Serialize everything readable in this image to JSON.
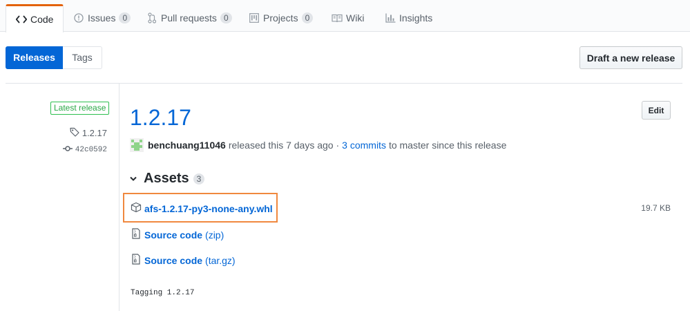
{
  "tabs": [
    {
      "label": "Code",
      "icon": "code-icon",
      "count": null
    },
    {
      "label": "Issues",
      "icon": "issue-icon",
      "count": "0"
    },
    {
      "label": "Pull requests",
      "icon": "pull-request-icon",
      "count": "0"
    },
    {
      "label": "Projects",
      "icon": "project-icon",
      "count": "0"
    },
    {
      "label": "Wiki",
      "icon": "book-icon",
      "count": null
    },
    {
      "label": "Insights",
      "icon": "graph-icon",
      "count": null
    }
  ],
  "subnav": {
    "releases": "Releases",
    "tags": "Tags"
  },
  "actions": {
    "draft": "Draft a new release",
    "edit": "Edit"
  },
  "release": {
    "badge": "Latest release",
    "tag": "1.2.17",
    "commit": "42c0592",
    "title": "1.2.17",
    "author": "benchuang11046",
    "released_text": "released this 7 days ago ·",
    "commits_link": "3 commits",
    "commits_suffix": "to master since this release",
    "assets_title": "Assets",
    "assets_count": "3",
    "assets": [
      {
        "name": "afs-1.2.17-py3-none-any.whl",
        "size": "19.7 KB"
      },
      {
        "name": "Source code",
        "format": "(zip)"
      },
      {
        "name": "Source code",
        "format": "(tar.gz)"
      }
    ],
    "tag_message": "Tagging 1.2.17"
  },
  "colors": {
    "accent": "#0366d6",
    "tab_active_border": "#e36209",
    "badge_green": "#28a745",
    "highlight": "#f0883e"
  }
}
